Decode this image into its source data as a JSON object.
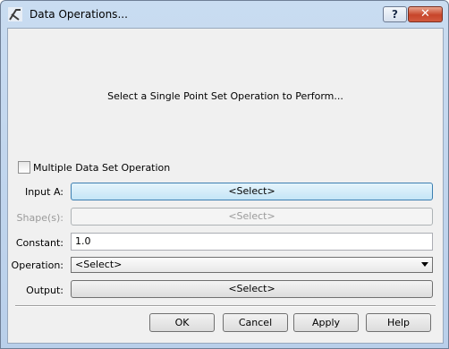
{
  "window": {
    "title": "Data Operations...",
    "help_label": "?",
    "close_label": "✕"
  },
  "prompt": "Select a Single Point Set Operation to Perform...",
  "multiple_op": {
    "label": "Multiple Data Set Operation",
    "checked": false
  },
  "input_a": {
    "label": "Input A:",
    "value": "<Select>"
  },
  "shapes": {
    "label": "Shape(s):",
    "value": "<Select>",
    "enabled": false
  },
  "constant": {
    "label": "Constant:",
    "value": "1.0"
  },
  "operation": {
    "label": "Operation:",
    "value": "<Select>"
  },
  "output": {
    "label": "Output:",
    "value": "<Select>"
  },
  "buttons": {
    "ok": "OK",
    "cancel": "Cancel",
    "apply": "Apply",
    "help": "Help"
  }
}
